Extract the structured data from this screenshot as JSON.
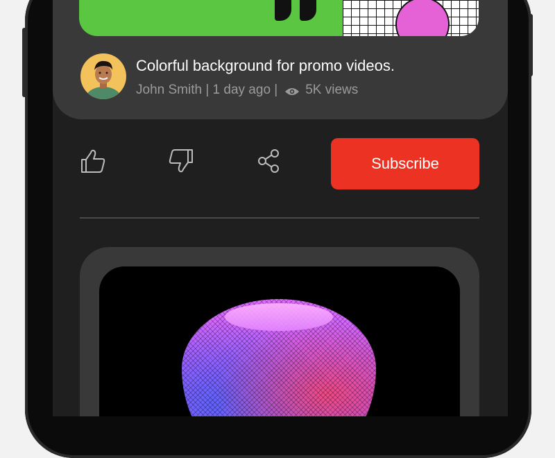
{
  "video": {
    "title": "Colorful background for promo videos.",
    "author": "John Smith",
    "sep1": " | ",
    "posted": "1 day ago",
    "sep2": " |",
    "views": "5K views"
  },
  "actions": {
    "like_icon": "thumbs-up-icon",
    "dislike_icon": "thumbs-down-icon",
    "share_icon": "share-icon",
    "subscribe_label": "Subscribe"
  },
  "colors": {
    "background": "#1f1f1f",
    "card": "#393939",
    "subscribe": "#ec3323",
    "thumbnail_green": "#5ac641",
    "thumbnail_pink": "#e462d5"
  }
}
